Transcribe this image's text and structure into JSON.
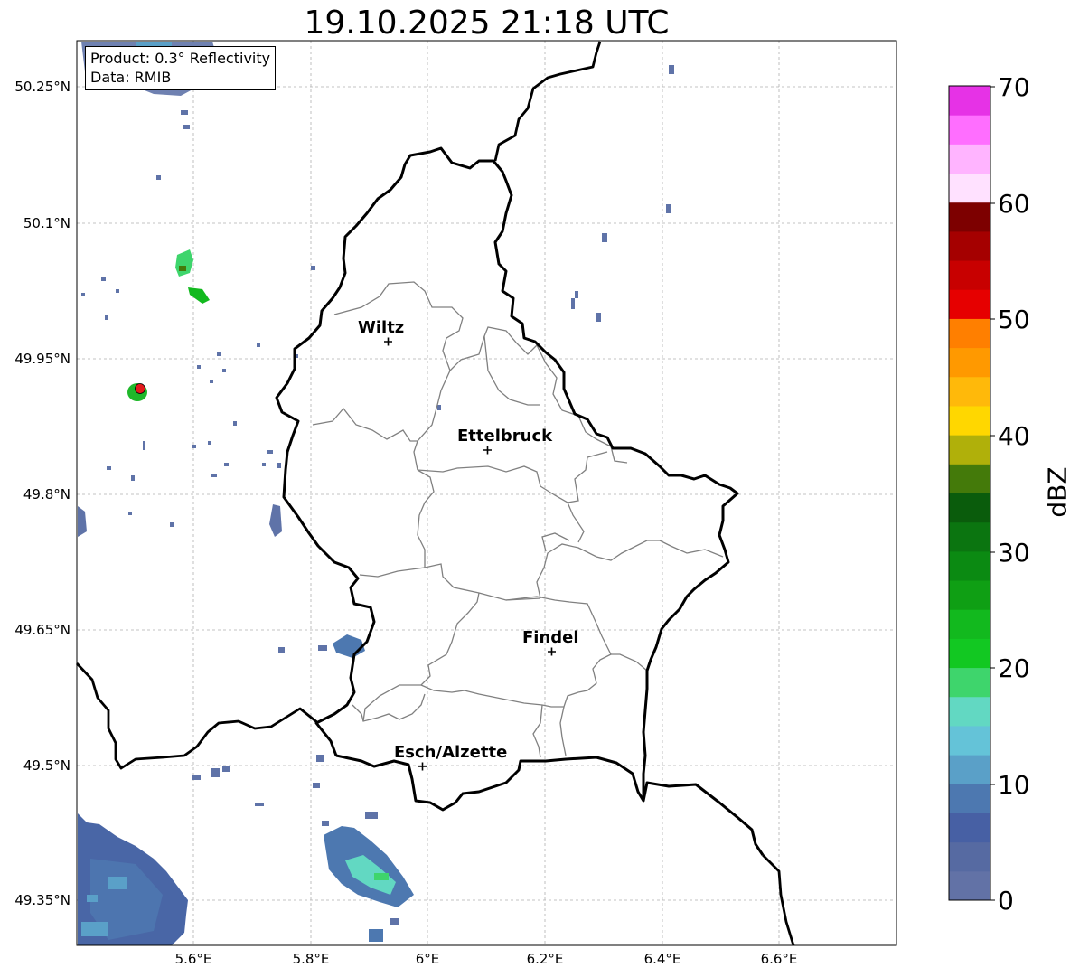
{
  "title": "19.10.2025 21:18 UTC",
  "info": {
    "product": "Product: 0.3° Reflectivity",
    "data": "Data: RMIB"
  },
  "axes": {
    "lat_ticks": [
      "50.25°N",
      "50.1°N",
      "49.95°N",
      "49.8°N",
      "49.65°N",
      "49.5°N",
      "49.35°N"
    ],
    "lon_ticks": [
      "5.6°E",
      "5.8°E",
      "6°E",
      "6.2°E",
      "6.4°E",
      "6.6°E"
    ],
    "grid": true
  },
  "colorbar": {
    "label": "dBZ",
    "ticks": [
      "0",
      "10",
      "20",
      "30",
      "40",
      "50",
      "60",
      "70"
    ],
    "colors": [
      "#6272a6",
      "#566aa2",
      "#4760a4",
      "#4d78b0",
      "#5aa0c8",
      "#64c3d8",
      "#62d8c2",
      "#3ed56c",
      "#12c822",
      "#12b91e",
      "#0f9f14",
      "#0b8a12",
      "#0b7510",
      "#0a5c0c",
      "#447a0a",
      "#b0b00a",
      "#ffd700",
      "#ffb90a",
      "#ff9900",
      "#ff7f00",
      "#e60000",
      "#c80000",
      "#a50000",
      "#7d0000",
      "#ffe1ff",
      "#ffb4ff",
      "#ff6eff",
      "#e632e6"
    ]
  },
  "cities": [
    {
      "name": "Wiltz"
    },
    {
      "name": "Ettelbruck"
    },
    {
      "name": "Findel"
    },
    {
      "name": "Esch/Alzette"
    }
  ],
  "radar_site": {
    "color": "#e31a1c"
  }
}
